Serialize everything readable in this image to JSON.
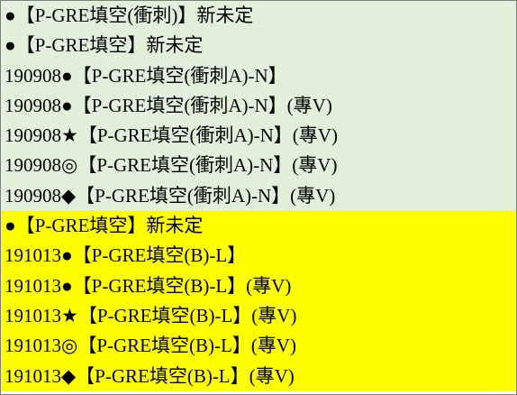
{
  "colors": {
    "green_fill": "#e2efda",
    "yellow_fill": "#ffff00",
    "text": "#000000"
  },
  "rows": [
    {
      "text": "●【P-GRE填空(衝刺)】新未定",
      "fill": "green"
    },
    {
      "text": "●【P-GRE填空】新未定",
      "fill": "green"
    },
    {
      "text": "190908●【P-GRE填空(衝刺A)-N】",
      "fill": "green"
    },
    {
      "text": "190908●【P-GRE填空(衝刺A)-N】(專V)",
      "fill": "green"
    },
    {
      "text": "190908★【P-GRE填空(衝刺A)-N】(專V)",
      "fill": "green"
    },
    {
      "text": "190908◎【P-GRE填空(衝刺A)-N】(專V)",
      "fill": "green"
    },
    {
      "text": "190908◆【P-GRE填空(衝刺A)-N】(專V)",
      "fill": "green"
    },
    {
      "text": "●【P-GRE填空】新未定",
      "fill": "yellow"
    },
    {
      "text": "191013●【P-GRE填空(B)-L】",
      "fill": "yellow"
    },
    {
      "text": "191013●【P-GRE填空(B)-L】(專V)",
      "fill": "yellow"
    },
    {
      "text": "191013★【P-GRE填空(B)-L】(專V)",
      "fill": "yellow"
    },
    {
      "text": "191013◎【P-GRE填空(B)-L】(專V)",
      "fill": "yellow"
    },
    {
      "text": "191013◆【P-GRE填空(B)-L】(專V)",
      "fill": "yellow"
    }
  ]
}
